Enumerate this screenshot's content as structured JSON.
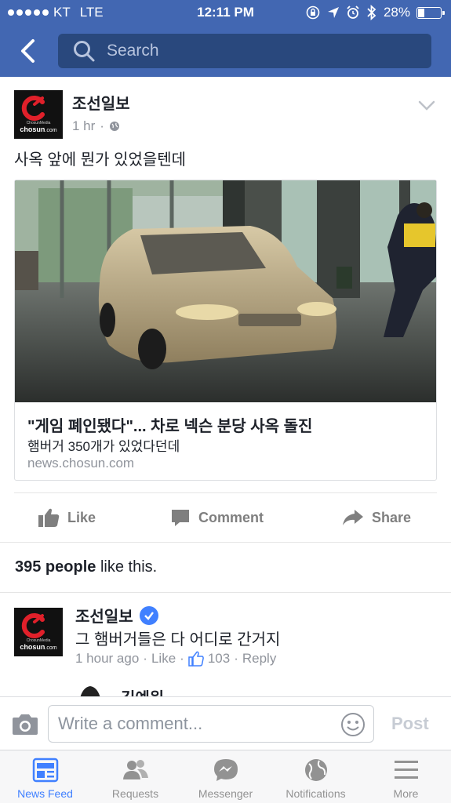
{
  "status_bar": {
    "carrier": "KT",
    "network": "LTE",
    "time": "12:11 PM",
    "battery": "28%",
    "battery_level": 0.28
  },
  "nav": {
    "search_placeholder": "Search"
  },
  "post": {
    "author": "조선일보",
    "time": "1 hr",
    "text": "사옥 앞에 뭔가 있었을텐데",
    "logo": {
      "small_text": "ChosunMedia",
      "brand_text": "chosun",
      "brand_suffix": ".com"
    },
    "link": {
      "title": "\"게임 폐인됐다\"... 차로 넥슨 분당 사옥 돌진",
      "description": "햄버거 350개가 있었다던데",
      "domain": "news.chosun.com"
    }
  },
  "actions": {
    "like": "Like",
    "comment": "Comment",
    "share": "Share"
  },
  "likes_summary": {
    "count": "395 people",
    "suffix": " like this."
  },
  "comment": {
    "author": "조선일보",
    "text": "그 햄버거들은 다 어디로 간거지",
    "time": "1 hour ago",
    "like_label": "Like",
    "like_count": "103",
    "reply_label": "Reply",
    "separator": "·"
  },
  "next_comment": {
    "author": "김예원"
  },
  "composer": {
    "placeholder": "Write a comment...",
    "post_label": "Post"
  },
  "tabbar": {
    "items": [
      {
        "label": "News Feed",
        "icon": "news-feed-icon"
      },
      {
        "label": "Requests",
        "icon": "requests-icon"
      },
      {
        "label": "Messenger",
        "icon": "messenger-icon"
      },
      {
        "label": "Notifications",
        "icon": "globe-icon"
      },
      {
        "label": "More",
        "icon": "menu-icon"
      }
    ]
  },
  "colors": {
    "brand_blue": "#4267b2",
    "search_bg": "#29487d",
    "active_tab": "#4080ff",
    "muted_text": "#90949c"
  }
}
